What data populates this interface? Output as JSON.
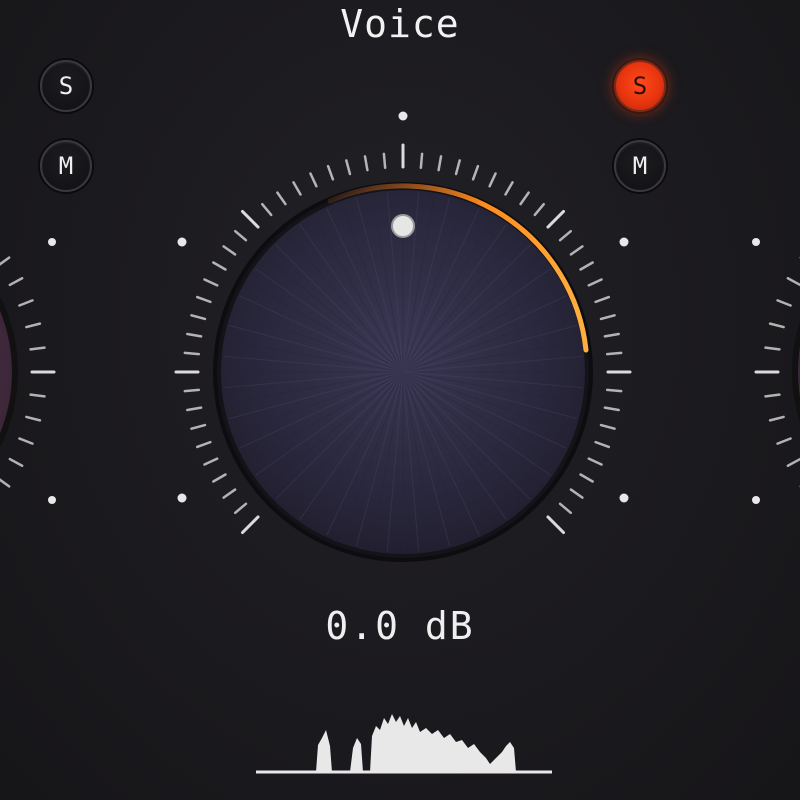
{
  "channel": {
    "name": "Voice",
    "gain_readout": "0.0 dB",
    "gain_db": 0.0
  },
  "left_channel": {
    "solo_label": "S",
    "mute_label": "M",
    "solo_active": false
  },
  "right_channel": {
    "solo_label": "S",
    "mute_label": "M",
    "solo_active": true
  },
  "colors": {
    "background": "#1b1a1e",
    "solo_active": "#f03c12",
    "knob_arc_accent": "#ff8a1a",
    "tick": "#e8e8e8"
  },
  "icons": [
    "knob-indicator-dot",
    "spectrum-waveform"
  ]
}
